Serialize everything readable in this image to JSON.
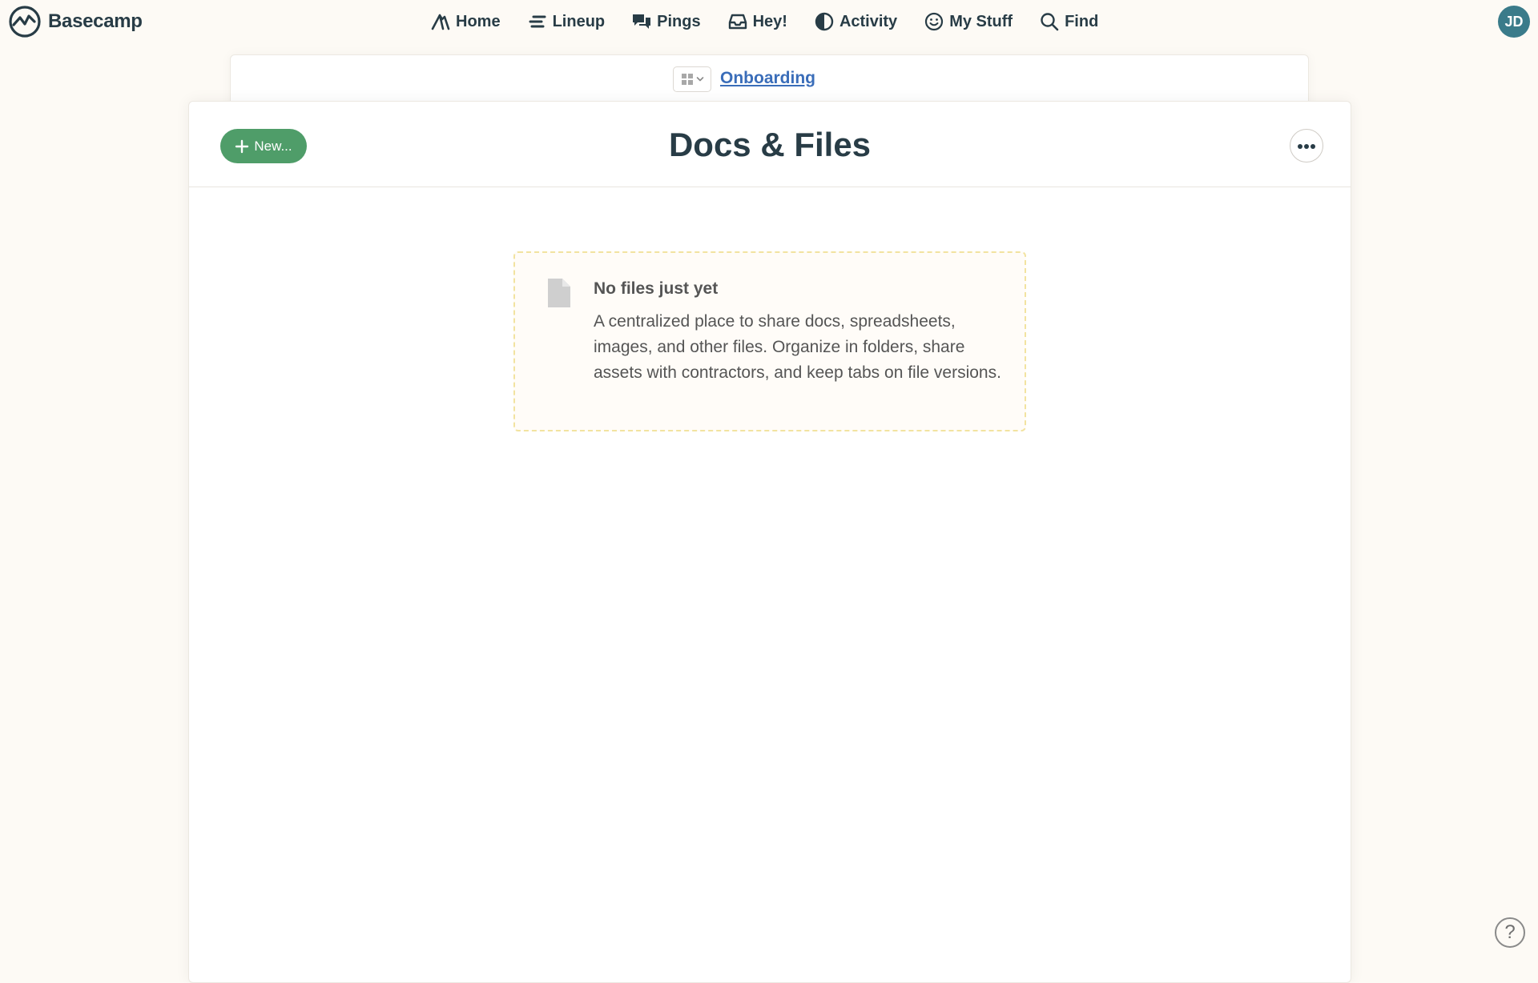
{
  "brand": {
    "name": "Basecamp",
    "icon": "basecamp-logo-icon"
  },
  "nav": {
    "items": [
      {
        "label": "Home",
        "icon": "home-icon"
      },
      {
        "label": "Lineup",
        "icon": "lineup-icon"
      },
      {
        "label": "Pings",
        "icon": "pings-icon"
      },
      {
        "label": "Hey!",
        "icon": "inbox-icon"
      },
      {
        "label": "Activity",
        "icon": "activity-icon"
      },
      {
        "label": "My Stuff",
        "icon": "smiley-icon"
      },
      {
        "label": "Find",
        "icon": "search-icon"
      }
    ]
  },
  "user": {
    "initials": "JD",
    "avatar_color": "#3a7b8a"
  },
  "project": {
    "name": "Onboarding",
    "link_color": "#3a6db9"
  },
  "page": {
    "title": "Docs & Files",
    "new_button_label": "New...",
    "accent_color": "#4f9d69"
  },
  "empty_state": {
    "title": "No files just yet",
    "description": "A centralized place to share docs, spreadsheets, images, and other files. Organize in folders, share assets with contractors, and keep tabs on file versions."
  },
  "help": {
    "label": "?"
  }
}
